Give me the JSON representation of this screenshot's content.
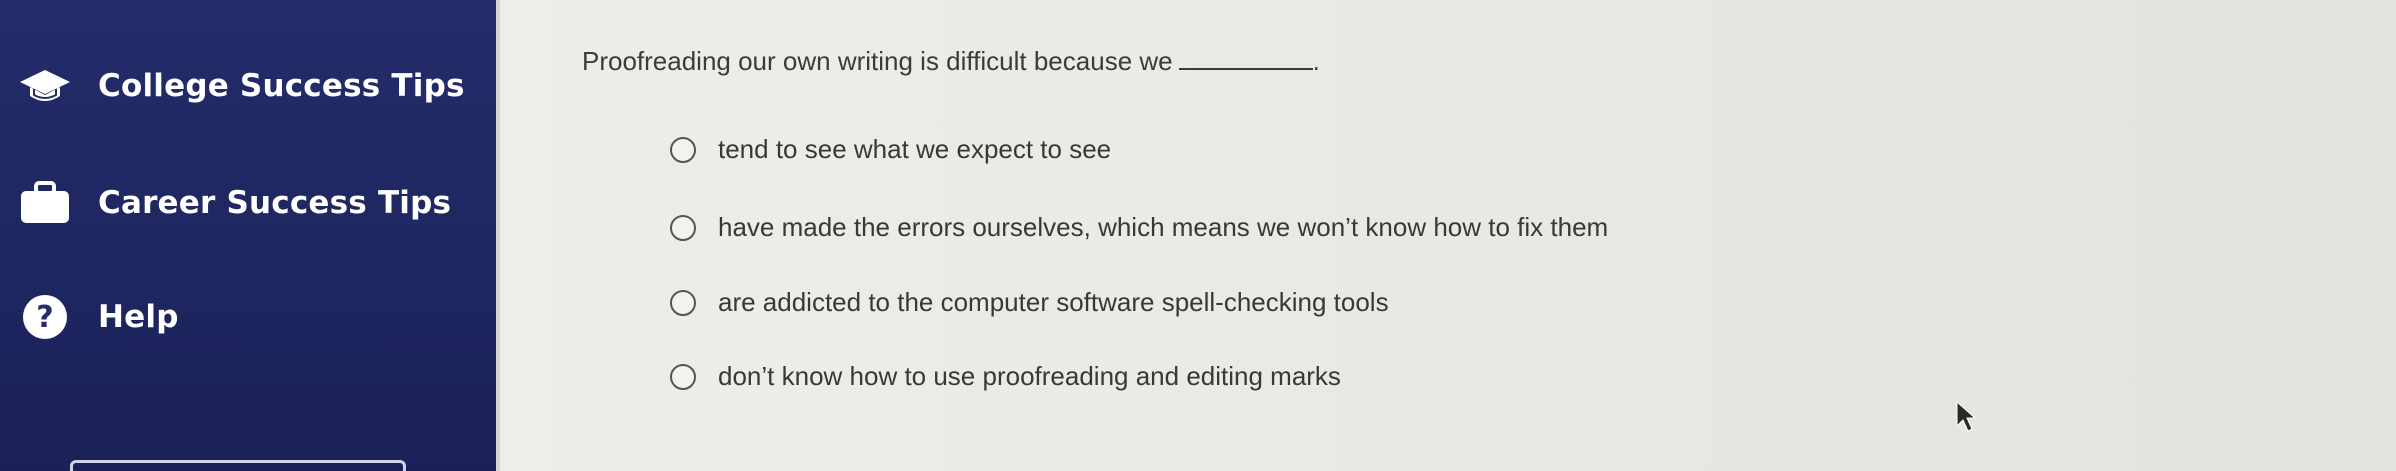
{
  "sidebar": {
    "items": [
      {
        "label": "College Success Tips",
        "icon": "graduation-cap-icon"
      },
      {
        "label": "Career Success Tips",
        "icon": "briefcase-icon"
      },
      {
        "label": "Help",
        "icon": "help-icon",
        "icon_glyph": "?"
      }
    ]
  },
  "question": {
    "text": "Proofreading our own writing is difficult because we",
    "end": ".",
    "options": [
      "tend to see what we expect to see",
      "have made the errors ourselves, which means we won’t know how to fix them",
      "are addicted to the computer software spell-checking tools",
      "don’t know how to use proofreading and editing marks"
    ]
  },
  "colors": {
    "sidebar_bg": "#242d6a",
    "page_bg": "#e9e8e4",
    "text": "#3b3b3b"
  }
}
